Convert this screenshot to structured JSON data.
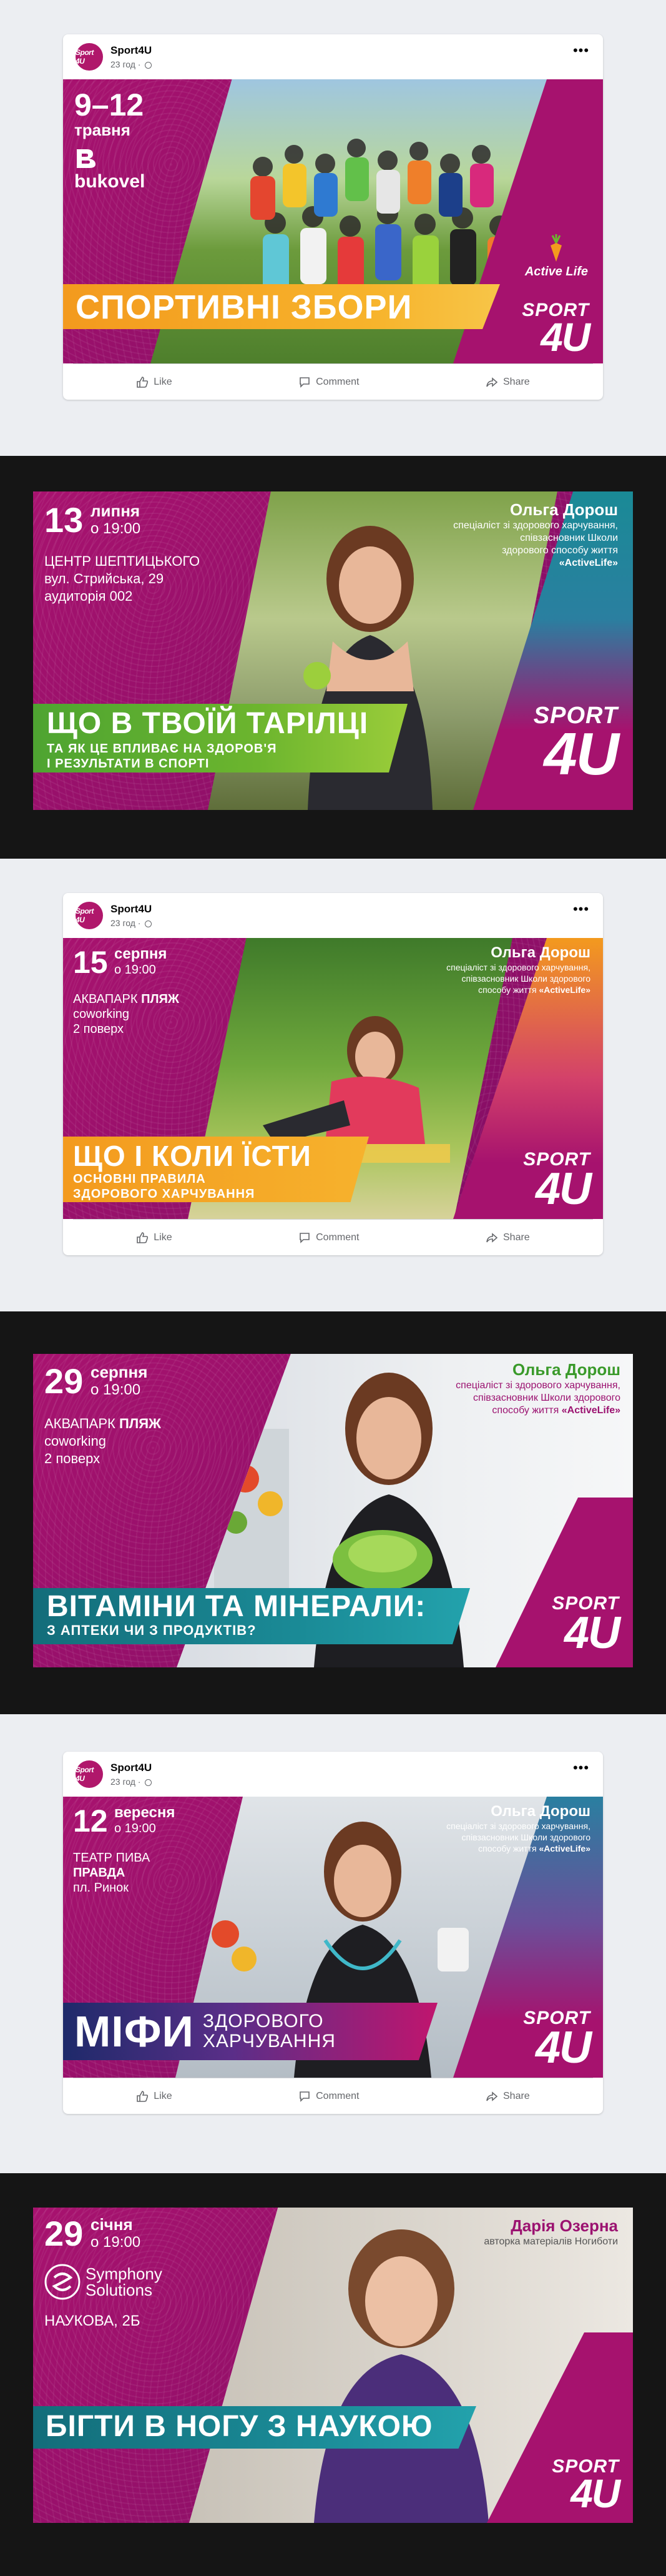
{
  "account": {
    "name": "Sport4U",
    "time": "23 год",
    "avatar_text": "Sport 4U"
  },
  "actions": {
    "like": "Like",
    "comment": "Comment",
    "share": "Share"
  },
  "posts": [
    {
      "date_range": "9–12",
      "month": "травня",
      "brand": "bukovel",
      "partner": "Active Life",
      "headline": "СПОРТИВНІ ЗБОРИ",
      "logo_top": "SPORT",
      "logo_bottom": "4U"
    },
    {
      "day": "13",
      "month": "липня",
      "time": "о 19:00",
      "venue": [
        "ЦЕНТР ШЕПТИЦЬКОГО",
        "вул. Стрийська, 29",
        "аудиторія 002"
      ],
      "speaker_name": "Ольга Дорош",
      "speaker_desc": [
        "спеціаліст зі здорового харчування,",
        "співзасновник Школи",
        "здорового способу життя"
      ],
      "speaker_brand": "«ActiveLife»",
      "headline": "ЩО В ТВОЇЙ ТАРІЛЦІ",
      "subline": [
        "ТА ЯК ЦЕ ВПЛИВАЄ НА ЗДОРОВ'Я",
        "І РЕЗУЛЬТАТИ В СПОРТІ"
      ],
      "logo_top": "SPORT",
      "logo_bottom": "4U"
    },
    {
      "day": "15",
      "month": "серпня",
      "time": "о 19:00",
      "venue_a": "АКВАПАРК",
      "venue_b": "ПЛЯЖ",
      "venue": [
        "coworking",
        "2 поверх"
      ],
      "speaker_name": "Ольга Дорош",
      "speaker_desc": [
        "спеціаліст зі здорового харчування,",
        "співзасновник Школи здорового",
        "способу життя"
      ],
      "speaker_brand": "«ActiveLife»",
      "headline": "ЩО І КОЛИ ЇСТИ",
      "subline": [
        "ОСНОВНІ ПРАВИЛА",
        "ЗДОРОВОГО ХАРЧУВАННЯ"
      ],
      "logo_top": "SPORT",
      "logo_bottom": "4U"
    },
    {
      "day": "29",
      "month": "серпня",
      "time": "о 19:00",
      "venue_a": "АКВАПАРК",
      "venue_b": "ПЛЯЖ",
      "venue": [
        "coworking",
        "2 поверх"
      ],
      "speaker_name": "Ольга Дорош",
      "speaker_desc": [
        "спеціаліст зі здорового харчування,",
        "співзасновник Школи здорового",
        "способу життя"
      ],
      "speaker_brand": "«ActiveLife»",
      "headline": "ВІТАМІНИ ТА МІНЕРАЛИ:",
      "subline": [
        "З АПТЕКИ ЧИ З ПРОДУКТІВ?"
      ],
      "logo_top": "SPORT",
      "logo_bottom": "4U"
    },
    {
      "day": "12",
      "month": "вересня",
      "time": "о 19:00",
      "venue_a": "ТЕАТР ПИВА",
      "venue_b": "ПРАВДА",
      "venue": [
        "пл. Ринок"
      ],
      "speaker_name": "Ольга Дорош",
      "speaker_desc": [
        "спеціаліст зі здорового харчування,",
        "співзасновник Школи здорового",
        "способу життя"
      ],
      "speaker_brand": "«ActiveLife»",
      "headline": "МІФИ",
      "subline": [
        "ЗДОРОВОГО",
        "ХАРЧУВАННЯ"
      ],
      "logo_top": "SPORT",
      "logo_bottom": "4U"
    },
    {
      "day": "29",
      "month": "січня",
      "time": "о 19:00",
      "sponsor_a": "Symphony",
      "sponsor_b": "Solutions",
      "venue": [
        "НАУКОВА, 2Б"
      ],
      "speaker_name": "Дарія Озерна",
      "speaker_desc": [
        "авторка матеріалів Ногиботи"
      ],
      "headline": "БІГТИ В НОГУ З НАУКОЮ",
      "logo_top": "SPORT",
      "logo_bottom": "4U"
    }
  ],
  "colors": {
    "magenta": "#a8126f",
    "orange": "#f39a1e",
    "green": "#6cb52e",
    "teal": "#1a8a96",
    "dark_band": "#151515",
    "light_band": "#eceef2"
  }
}
